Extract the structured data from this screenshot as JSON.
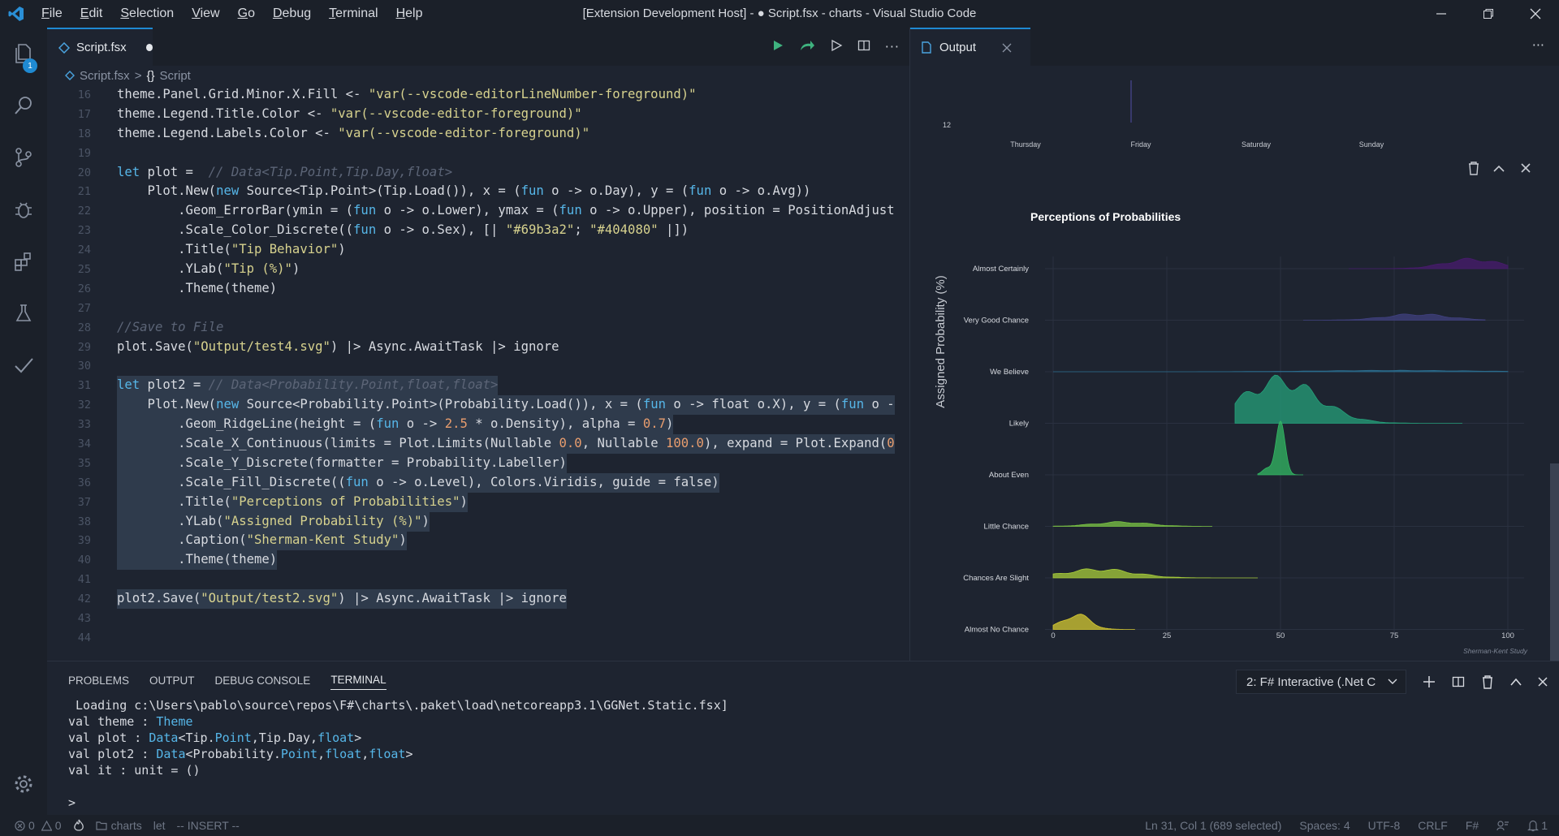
{
  "window": {
    "title": "[Extension Development Host] - ● Script.fsx - charts - Visual Studio Code",
    "menu": [
      "File",
      "Edit",
      "Selection",
      "View",
      "Go",
      "Debug",
      "Terminal",
      "Help"
    ]
  },
  "activity": {
    "explorer_badge": "1"
  },
  "editor": {
    "tab_label": "Script.fsx",
    "breadcrumb": {
      "file": "Script.fsx",
      "symbol_glyph": "{}",
      "symbol": "Script"
    },
    "lines": [
      {
        "num": "16",
        "text": "theme.Panel.Grid.Minor.X.Fill <- \"var(--vscode-editorLineNumber-foreground)\""
      },
      {
        "num": "17",
        "text": "theme.Legend.Title.Color <- \"var(--vscode-editor-foreground)\""
      },
      {
        "num": "18",
        "text": "theme.Legend.Labels.Color <- \"var(--vscode-editor-foreground)\""
      },
      {
        "num": "19",
        "text": ""
      },
      {
        "num": "20",
        "text": "let plot =  // Data<Tip.Point,Tip.Day,float>"
      },
      {
        "num": "21",
        "text": "    Plot.New(new Source<Tip.Point>(Tip.Load()), x = (fun o -> o.Day), y = (fun o -> o.Avg))"
      },
      {
        "num": "22",
        "text": "        .Geom_ErrorBar(ymin = (fun o -> o.Lower), ymax = (fun o -> o.Upper), position = PositionAdjust"
      },
      {
        "num": "23",
        "text": "        .Scale_Color_Discrete((fun o -> o.Sex), [| \"#69b3a2\"; \"#404080\" |])"
      },
      {
        "num": "24",
        "text": "        .Title(\"Tip Behavior\")"
      },
      {
        "num": "25",
        "text": "        .YLab(\"Tip (%)\")"
      },
      {
        "num": "26",
        "text": "        .Theme(theme)"
      },
      {
        "num": "27",
        "text": ""
      },
      {
        "num": "28",
        "text": "//Save to File"
      },
      {
        "num": "29",
        "text": "plot.Save(\"Output/test4.svg\") |> Async.AwaitTask |> ignore"
      },
      {
        "num": "30",
        "text": ""
      },
      {
        "num": "31",
        "text": "let plot2 = // Data<Probability.Point,float,float>"
      },
      {
        "num": "32",
        "text": "    Plot.New(new Source<Probability.Point>(Probability.Load()), x = (fun o -> float o.X), y = (fun o -"
      },
      {
        "num": "33",
        "text": "        .Geom_RidgeLine(height = (fun o -> 2.5 * o.Density), alpha = 0.7)"
      },
      {
        "num": "34",
        "text": "        .Scale_X_Continuous(limits = Plot.Limits(Nullable 0.0, Nullable 100.0), expand = Plot.Expand(0"
      },
      {
        "num": "35",
        "text": "        .Scale_Y_Discrete(formatter = Probability.Labeller)"
      },
      {
        "num": "36",
        "text": "        .Scale_Fill_Discrete((fun o -> o.Level), Colors.Viridis, guide = false)"
      },
      {
        "num": "37",
        "text": "        .Title(\"Perceptions of Probabilities\")"
      },
      {
        "num": "38",
        "text": "        .YLab(\"Assigned Probability (%)\")"
      },
      {
        "num": "39",
        "text": "        .Caption(\"Sherman-Kent Study\")"
      },
      {
        "num": "40",
        "text": "        .Theme(theme)"
      },
      {
        "num": "41",
        "text": ""
      },
      {
        "num": "42",
        "text": "plot2.Save(\"Output/test2.svg\") |> Async.AwaitTask |> ignore"
      },
      {
        "num": "43",
        "text": ""
      },
      {
        "num": "44",
        "text": ""
      }
    ]
  },
  "output": {
    "tab_label": "Output",
    "top_chart": {
      "y_tick": "12",
      "x_ticks": [
        "Thursday",
        "Friday",
        "Saturday",
        "Sunday"
      ]
    },
    "chart_data": {
      "type": "area",
      "title": "Perceptions of Probabilities",
      "ylabel": "Assigned Probability (%)",
      "caption": "Sherman-Kent Study",
      "xlim": [
        0,
        100
      ],
      "x_ticks": [
        "0",
        "25",
        "50",
        "75",
        "100"
      ],
      "categories": [
        "Almost Certainly",
        "Very Good Chance",
        "We Believe",
        "Likely",
        "About Even",
        "Little Chance",
        "Chances Are Slight",
        "Almost No Chance"
      ],
      "colors": [
        "#481b6d",
        "#40407e",
        "#2b6d8e",
        "#25a07a",
        "#33b863",
        "#7cc544",
        "#a8cd3a",
        "#d6c931"
      ],
      "series": [
        {
          "peak_x": 92,
          "peak_height": 0.22,
          "range": [
            65,
            100
          ]
        },
        {
          "peak_x": 80,
          "peak_height": 0.14,
          "range": [
            55,
            95
          ]
        },
        {
          "peak_x": 75,
          "peak_height": 0.03,
          "range": [
            0,
            100
          ]
        },
        {
          "peak_x": 50,
          "peak_height": 1.0,
          "range": [
            40,
            90
          ]
        },
        {
          "peak_x": 50,
          "peak_height": 1.1,
          "range": [
            45,
            55
          ]
        },
        {
          "peak_x": 15,
          "peak_height": 0.1,
          "range": [
            0,
            35
          ]
        },
        {
          "peak_x": 10,
          "peak_height": 0.2,
          "range": [
            0,
            45
          ]
        },
        {
          "peak_x": 5,
          "peak_height": 0.35,
          "range": [
            0,
            18
          ]
        }
      ]
    }
  },
  "panel": {
    "tabs": [
      "PROBLEMS",
      "OUTPUT",
      "DEBUG CONSOLE",
      "TERMINAL"
    ],
    "terminal_select": "2: F# Interactive (.Net C",
    "terminal_lines": [
      {
        "pre": " Loading c:\\Users\\pablo\\source\\repos\\F#\\charts\\.paket\\load\\netcoreapp3.1\\GGNet.Static.fsx]",
        "ty": "",
        "post": ""
      },
      {
        "pre": "val theme : ",
        "ty": "Theme",
        "post": ""
      },
      {
        "pre": "val plot : ",
        "ty": "Data",
        "post": "<Tip.Point,Tip.Day,float>"
      },
      {
        "pre": "val plot2 : ",
        "ty": "Data",
        "post": "<Probability.Point,float,float>"
      },
      {
        "pre": "val it : unit = ()",
        "ty": "",
        "post": ""
      },
      {
        "pre": "",
        "ty": "",
        "post": ""
      },
      {
        "pre": ">",
        "ty": "",
        "post": ""
      }
    ]
  },
  "status": {
    "errors": "0",
    "warnings": "0",
    "folder": "charts",
    "mode1": "let",
    "mode2": "-- INSERT --",
    "position": "Ln 31, Col 1 (689 selected)",
    "spaces": "Spaces: 4",
    "encoding": "UTF-8",
    "eol": "CRLF",
    "language": "F#",
    "notifications": "1"
  }
}
